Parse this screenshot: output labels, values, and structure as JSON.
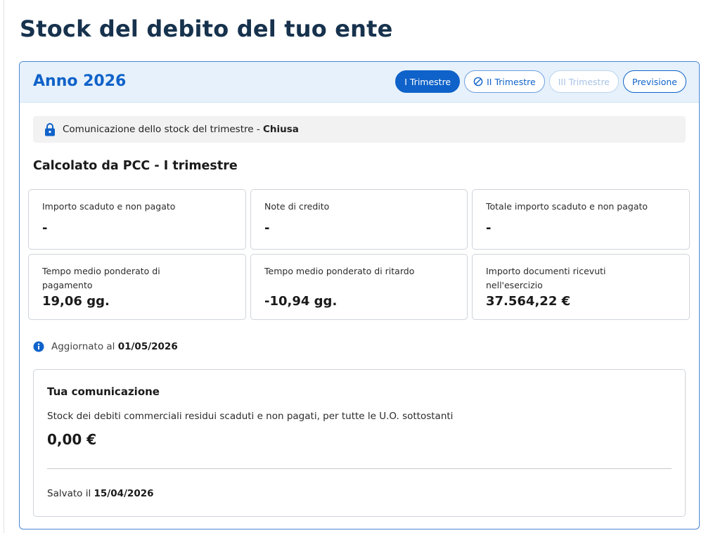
{
  "page": {
    "title": "Stock del debito del tuo ente"
  },
  "year_card": {
    "title": "Anno 2026",
    "tabs": [
      {
        "label": "I Trimestre",
        "state": "active"
      },
      {
        "label": "II Trimestre",
        "state": "enabled",
        "icon": "circle-slash-icon"
      },
      {
        "label": "III Trimestre",
        "state": "disabled"
      },
      {
        "label": "Previsione",
        "state": "enabled"
      }
    ]
  },
  "notice": {
    "icon": "lock-icon",
    "text": "Comunicazione dello stock del trimestre - ",
    "status": "Chiusa"
  },
  "pcc": {
    "title": "Calcolato da PCC - I trimestre",
    "metrics": [
      {
        "label": "Importo scaduto e non pagato",
        "value": "-"
      },
      {
        "label": "Note di credito",
        "value": "-"
      },
      {
        "label": "Totale importo scaduto e non pagato",
        "value": "-"
      },
      {
        "label_line1": "Tempo medio ponderato di",
        "label_line2": "pagamento",
        "value": "19,06 gg."
      },
      {
        "label": "Tempo medio ponderato di ritardo",
        "value": "-10,94 gg."
      },
      {
        "label_line1": "Importo documenti ricevuti",
        "label_line2": "nell'esercizio",
        "value": "37.564,22 €"
      }
    ]
  },
  "updated": {
    "icon": "info-icon",
    "prefix": "Aggiornato al",
    "date": "01/05/2026"
  },
  "communication": {
    "title": "Tua comunicazione",
    "description": "Stock dei debiti commerciali residui scaduti e non pagati, per tutte le U.O. sottostanti",
    "amount": "0,00 €",
    "saved_prefix": "Salvato il",
    "saved_date": "15/04/2026"
  },
  "colors": {
    "primary": "#0f62c9",
    "header_bg": "#e6f1fb",
    "card_border": "#4a86d6",
    "title": "#17324d"
  }
}
